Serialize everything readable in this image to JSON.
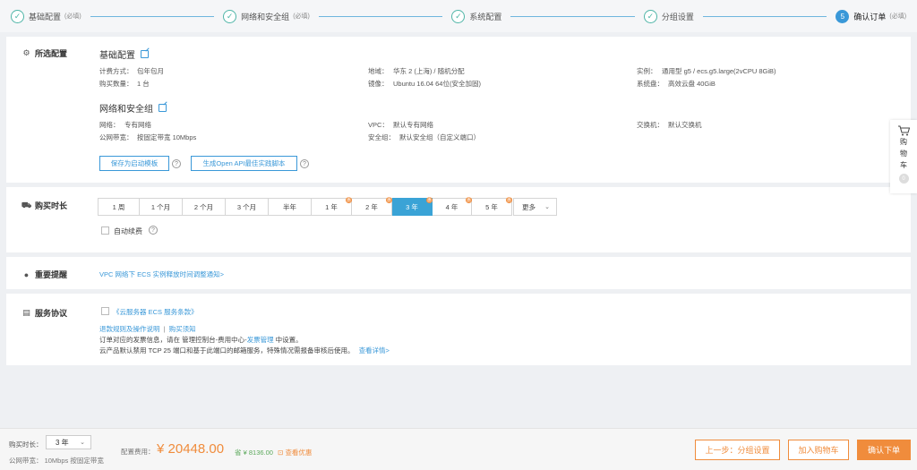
{
  "steps": [
    {
      "label": "基础配置",
      "req": "(必填)",
      "state": "done"
    },
    {
      "label": "网络和安全组",
      "req": "(必填)",
      "state": "done"
    },
    {
      "label": "系统配置",
      "req": "",
      "state": "done"
    },
    {
      "label": "分组设置",
      "req": "",
      "state": "done"
    },
    {
      "num": "5",
      "label": "确认订单",
      "req": "(必填)",
      "state": "active"
    }
  ],
  "selected_config": {
    "section_title": "所选配置",
    "basic": {
      "title": "基础配置",
      "billing_label": "计费方式：",
      "billing_value": "包年包月",
      "region_label": "地域：",
      "region_value": "华东 2 (上海) / 随机分配",
      "instance_label": "实例：",
      "instance_value": "通用型 g5 / ecs.g5.large(2vCPU 8GiB)",
      "qty_label": "购买数量：",
      "qty_value": "1 台",
      "image_label": "镜像：",
      "image_value": "Ubuntu 16.04 64位(安全加固)",
      "disk_label": "系统盘：",
      "disk_value": "高效云盘 40GiB"
    },
    "network": {
      "title": "网络和安全组",
      "net_label": "网络：",
      "net_value": "专有网络",
      "vpc_label": "VPC：",
      "vpc_value": "默认专有网络",
      "switch_label": "交换机：",
      "switch_value": "默认交换机",
      "bandwidth_label": "公网带宽：",
      "bandwidth_value": "按固定带宽 10Mbps",
      "sg_label": "安全组：",
      "sg_value": "默认安全组（自定义端口）"
    },
    "save_template": "保存为启动模板",
    "openapi": "生成Open API最佳实践脚本"
  },
  "duration": {
    "section_title": "购买时长",
    "options": [
      {
        "label": "1 周",
        "badge": ""
      },
      {
        "label": "1 个月",
        "badge": ""
      },
      {
        "label": "2 个月",
        "badge": ""
      },
      {
        "label": "3 个月",
        "badge": ""
      },
      {
        "label": "半年",
        "badge": ""
      },
      {
        "label": "1 年",
        "badge": "惠"
      },
      {
        "label": "2 年",
        "badge": "惠"
      },
      {
        "label": "3 年",
        "badge": "惠"
      },
      {
        "label": "4 年",
        "badge": "惠"
      },
      {
        "label": "5 年",
        "badge": "惠"
      }
    ],
    "selected": "3 年",
    "more": "更多",
    "auto_renew": "自动续费"
  },
  "notice": {
    "section_title": "重要提醒",
    "link": "VPC 网络下 ECS 实例释放时间调整通知>"
  },
  "agreement": {
    "section_title": "服务协议",
    "terms": "《云服务器 ECS 服务条款》",
    "refund": "退款规则及操作说明",
    "sep": "|",
    "buy_notes": "购买须知",
    "invoice_pre": "订单对应的发票信息，请在 管理控制台-费用中心-",
    "invoice_link": "发票管理",
    "invoice_post": " 中设置。",
    "tcp_text": "云产品默认禁用 TCP 25 端口和基于此端口的邮箱服务，特殊情况需报备审核后使用。",
    "tcp_link": "查看详情>"
  },
  "cart": {
    "label": "购物车",
    "count": "0"
  },
  "footer": {
    "duration_label": "购买时长：",
    "duration_value": "3 年",
    "bandwidth_label": "公网带宽：",
    "bandwidth_value": "10Mbps 按固定带宽",
    "price_label": "配置费用：",
    "price": "¥ 20448.00",
    "save_prefix": "省",
    "save_value": "¥ 8136.00",
    "discount_link": "查看优惠",
    "prev_btn": "上一步：分组设置",
    "add_cart_btn": "加入购物车",
    "confirm_btn": "确认下单"
  },
  "colors": {
    "accent": "#3a98d8",
    "orange": "#f08c3c",
    "teal": "#4fb5a7"
  }
}
